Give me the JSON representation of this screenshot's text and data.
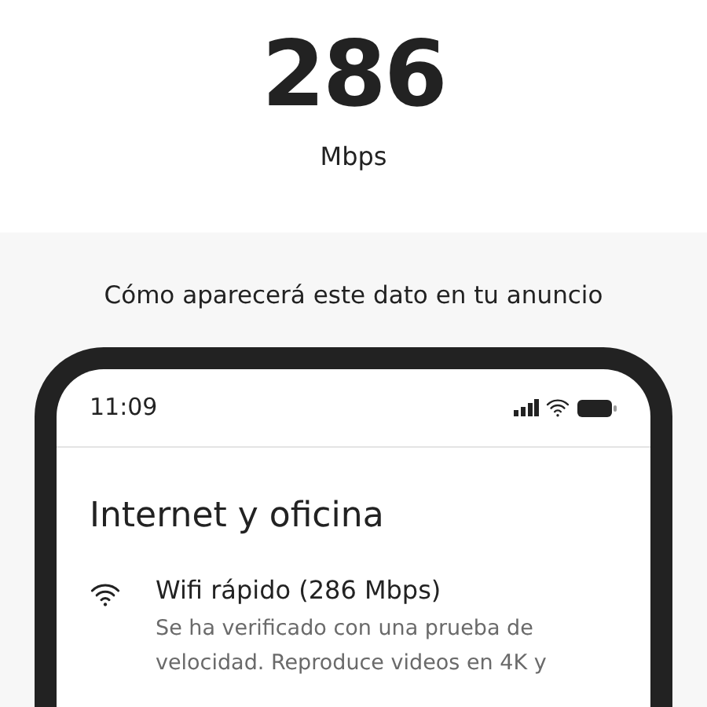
{
  "speed": {
    "value": "286",
    "unit": "Mbps"
  },
  "preview": {
    "caption": "Cómo aparecerá este dato en tu anuncio",
    "phone": {
      "time": "11:09",
      "title": "Internet y oficina",
      "amenities": [
        {
          "kind": "wifi",
          "name": "Wifi rápido (286 Mbps)",
          "description": "Se ha verificado con una prueba de velocidad. Reproduce videos en 4K y"
        }
      ]
    }
  }
}
